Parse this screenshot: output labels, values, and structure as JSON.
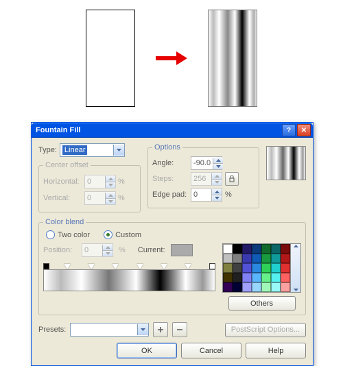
{
  "titlebar": {
    "title": "Fountain Fill"
  },
  "type": {
    "label": "Type:",
    "value": "Linear"
  },
  "center_offset": {
    "legend": "Center offset",
    "horizontal": {
      "label": "Horizontal:",
      "value": "0",
      "unit": "%"
    },
    "vertical": {
      "label": "Vertical:",
      "value": "0",
      "unit": "%"
    }
  },
  "options": {
    "legend": "Options",
    "angle": {
      "label": "Angle:",
      "value": "-90.0"
    },
    "steps": {
      "label": "Steps:",
      "value": "256"
    },
    "edge_pad": {
      "label": "Edge pad:",
      "value": "0",
      "unit": "%"
    }
  },
  "color_blend": {
    "legend": "Color blend",
    "two_color_label": "Two color",
    "custom_label": "Custom",
    "selected": "custom",
    "position": {
      "label": "Position:",
      "value": "0",
      "unit": "%"
    },
    "current_label": "Current:"
  },
  "palette_colors": [
    "#ffffff",
    "#000000",
    "#221a66",
    "#0b3a7a",
    "#116a2b",
    "#0a6666",
    "#7a0c0c",
    "#c0c0c0",
    "#808080",
    "#3a3ab0",
    "#0f5bb5",
    "#1a9a3f",
    "#109a9a",
    "#b31818",
    "#808040",
    "#404040",
    "#5252d6",
    "#2a88e0",
    "#2fd058",
    "#20cfcf",
    "#e03030",
    "#403300",
    "#202020",
    "#8080f5",
    "#5ab5ff",
    "#66f08a",
    "#55f0f0",
    "#ff6060",
    "#330055",
    "#000033",
    "#a0a0ff",
    "#99d6ff",
    "#a0f8b8",
    "#99f8f8",
    "#ffa0a0"
  ],
  "others_label": "Others",
  "presets": {
    "label": "Presets:",
    "value": ""
  },
  "postscript_label": "PostScript Options...",
  "buttons": {
    "ok": "OK",
    "cancel": "Cancel",
    "help": "Help"
  }
}
